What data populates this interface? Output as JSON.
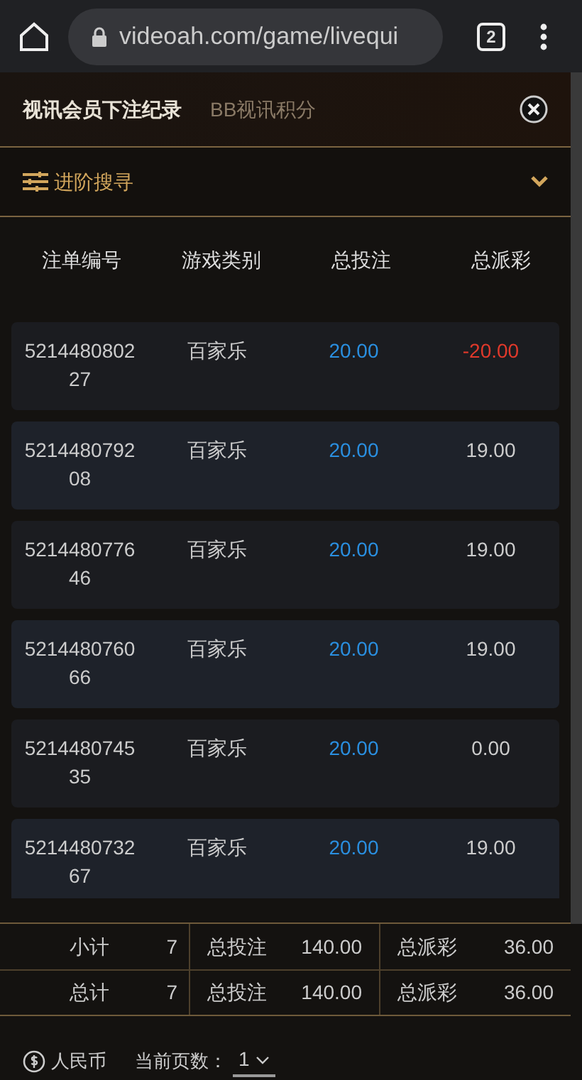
{
  "browser": {
    "url": "videoah.com/game/livequi",
    "tab_count": "2"
  },
  "tabs": [
    {
      "label": "视讯会员下注纪录",
      "selected": true
    },
    {
      "label": "BB视讯积分",
      "selected": false
    }
  ],
  "advanced_search": {
    "label": "进阶搜寻",
    "expanded": false
  },
  "table": {
    "columns": [
      "注单编号",
      "游戏类别",
      "总投注",
      "总派彩"
    ],
    "rows": [
      {
        "id": "521448080227",
        "game": "百家乐",
        "bet": "20.00",
        "payout": "-20.00",
        "negative": true
      },
      {
        "id": "521448079208",
        "game": "百家乐",
        "bet": "20.00",
        "payout": "19.00",
        "negative": false
      },
      {
        "id": "521448077646",
        "game": "百家乐",
        "bet": "20.00",
        "payout": "19.00",
        "negative": false
      },
      {
        "id": "521448076066",
        "game": "百家乐",
        "bet": "20.00",
        "payout": "19.00",
        "negative": false
      },
      {
        "id": "521448074535",
        "game": "百家乐",
        "bet": "20.00",
        "payout": "0.00",
        "negative": false
      },
      {
        "id": "521448073267",
        "game": "百家乐",
        "bet": "20.00",
        "payout": "19.00",
        "negative": false
      }
    ]
  },
  "summary": [
    {
      "label": "小计",
      "count": "7",
      "bet_label": "总投注",
      "bet": "140.00",
      "payout_label": "总派彩",
      "payout": "36.00"
    },
    {
      "label": "总计",
      "count": "7",
      "bet_label": "总投注",
      "bet": "140.00",
      "payout_label": "总派彩",
      "payout": "36.00"
    }
  ],
  "footer": {
    "currency": "人民币",
    "page_label": "当前页数：",
    "page": "1"
  }
}
